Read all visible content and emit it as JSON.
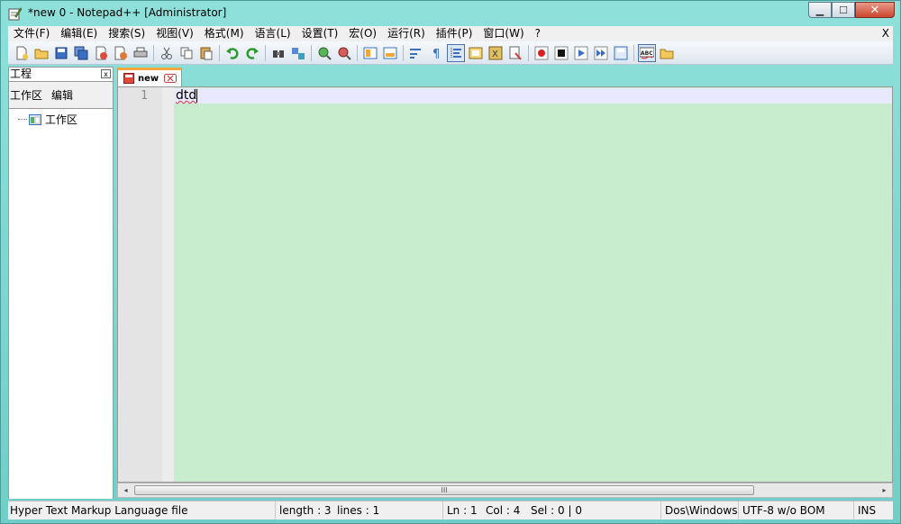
{
  "window": {
    "title": "*new  0 - Notepad++ [Administrator]",
    "controls": {
      "minimize": "▁",
      "maximize": "☐",
      "close": "✕"
    }
  },
  "menu": {
    "items": [
      "文件(F)",
      "编辑(E)",
      "搜索(S)",
      "视图(V)",
      "格式(M)",
      "语言(L)",
      "设置(T)",
      "宏(O)",
      "运行(R)",
      "插件(P)",
      "窗口(W)",
      "?"
    ],
    "close": "X"
  },
  "toolbar": {
    "icons": [
      "new-file-icon",
      "open-file-icon",
      "save-icon",
      "save-all-icon",
      "close-icon",
      "close-all-icon",
      "print-icon",
      "cut-icon",
      "copy-icon",
      "paste-icon",
      "undo-icon",
      "redo-icon",
      "find-icon",
      "replace-icon",
      "zoom-in-icon",
      "zoom-out-icon",
      "sync-vertical-icon",
      "sync-horizontal-icon",
      "word-wrap-icon",
      "show-all-chars-icon",
      "indent-guide-icon",
      "user-language-icon",
      "function-list-icon",
      "document-map-icon",
      "record-macro-icon",
      "stop-macro-icon",
      "play-macro-icon",
      "run-macro-multiple-icon",
      "save-macro-icon",
      "spell-check-icon",
      "folder-icon"
    ]
  },
  "project_panel": {
    "title": "工程",
    "close": "x",
    "menu": [
      "工作区",
      "编辑"
    ],
    "tree_root": "工作区"
  },
  "tab": {
    "label": "new"
  },
  "editor": {
    "line_number": "1",
    "text": "dtd"
  },
  "scrollbar": {
    "left": "◂",
    "right": "▸",
    "grip": "III"
  },
  "status": {
    "file_type": "Hyper Text Markup Language file",
    "length": "length : 3",
    "lines": "lines : 1",
    "ln": "Ln : 1",
    "col": "Col : 4",
    "sel": "Sel : 0 | 0",
    "eol": "Dos\\Windows",
    "encoding": "UTF-8 w/o BOM",
    "mode": "INS"
  },
  "colors": {
    "editor_bg": "#c7edce",
    "current_line": "#e8e8ff",
    "tab_accent": "#f3a73a",
    "window_frame": "#7fd3d0"
  }
}
